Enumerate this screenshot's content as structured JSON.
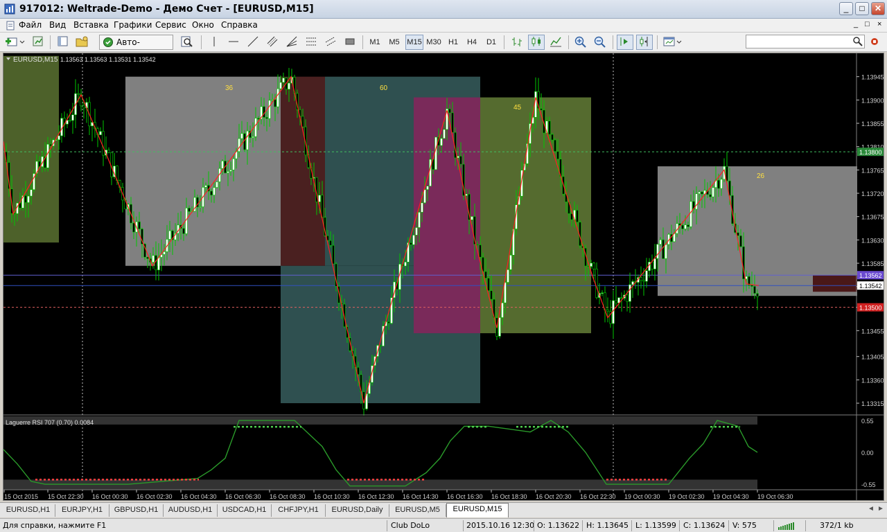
{
  "window": {
    "title": "917012: Weltrade-Demo - Демо Счет - [EURUSD,M15]",
    "buttons": {
      "minimize": "_",
      "maximize": "□",
      "close": "✕"
    }
  },
  "menu": {
    "items": [
      "Файл",
      "Вид",
      "Вставка",
      "Графики",
      "Сервис",
      "Окно",
      "Справка"
    ],
    "mdi": [
      "_",
      "□",
      "×"
    ]
  },
  "toolbar": {
    "autotrade_label": "Авто-торговля",
    "timeframes": [
      "M1",
      "M5",
      "M15",
      "M30",
      "H1",
      "H4",
      "D1"
    ],
    "active_timeframe": "M15",
    "search_placeholder": ""
  },
  "chart": {
    "symbol_label": "EURUSD,M15",
    "ohlc_label": "1.13563 1.13563 1.13531 1.13542",
    "price_labels": [
      "1.13945",
      "1.13900",
      "1.13855",
      "1.13810",
      "1.13765",
      "1.13720",
      "1.13675",
      "1.13630",
      "1.13585",
      "1.13540",
      "1.13500",
      "1.13455",
      "1.13405",
      "1.13360",
      "1.13315"
    ],
    "current_price": "1.13542",
    "bid_marker": "1.13562",
    "level_red": "1.13500",
    "level_green": "1.13800",
    "box_labels": [
      "36",
      "60",
      "45",
      "26"
    ],
    "time_labels": [
      "15 Oct 2015",
      "15 Oct 22:30",
      "16 Oct 00:30",
      "16 Oct 02:30",
      "16 Oct 04:30",
      "16 Oct 06:30",
      "16 Oct 08:30",
      "16 Oct 10:30",
      "16 Oct 12:30",
      "16 Oct 14:30",
      "16 Oct 16:30",
      "16 Oct 18:30",
      "16 Oct 20:30",
      "16 Oct 22:30",
      "19 Oct 00:30",
      "19 Oct 02:30",
      "19 Oct 04:30",
      "19 Oct 06:30"
    ],
    "indicator": {
      "label": "Laguerre RSI 707 (0.70) 0.0084",
      "levels": [
        "0.55",
        "0.00",
        "-0.55"
      ]
    }
  },
  "tabs": {
    "items": [
      "EURUSD,H1",
      "EURJPY,H1",
      "GBPUSD,H1",
      "AUDUSD,H1",
      "USDCAD,H1",
      "CHFJPY,H1",
      "EURUSD,Daily",
      "EURUSD,M5",
      "EURUSD,M15"
    ],
    "active": "EURUSD,M15",
    "nav_prev": "◄",
    "nav_next": "►"
  },
  "status": {
    "help": "Для справки, нажмите F1",
    "profile": "Club DoLo",
    "datetime": "2015.10.16 12:30",
    "open": "O: 1.13622",
    "high": "H: 1.13645",
    "low": "L: 1.13599",
    "close": "C: 1.13624",
    "volume": "V: 575",
    "traffic": "372/1 kb"
  },
  "colors": {
    "bull": "#ffffff",
    "bear": "#000000",
    "wick": "#00c800",
    "zigzag": "#ff2020",
    "box_gray": "#808080",
    "box_teal": "#2f5050",
    "box_olive": "#556b2f",
    "box_maroon": "#4a2020",
    "box_magenta": "#7a2a5a"
  }
}
